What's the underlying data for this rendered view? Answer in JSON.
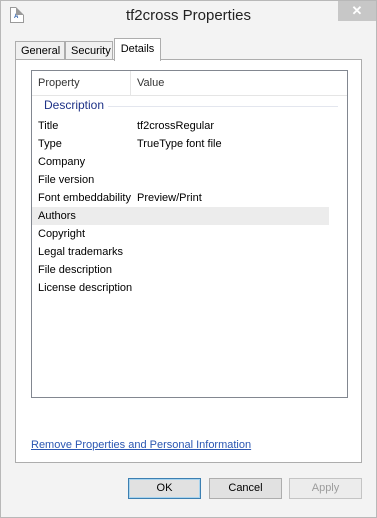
{
  "window": {
    "title": "tf2cross Properties",
    "close_glyph": "✕",
    "icon": "font-file-icon",
    "icon_glyph": "A"
  },
  "tabs": [
    {
      "label": "General",
      "selected": false
    },
    {
      "label": "Security",
      "selected": false
    },
    {
      "label": "Details",
      "selected": true
    }
  ],
  "details": {
    "columns": {
      "property": "Property",
      "value": "Value"
    },
    "group": "Description",
    "rows": [
      {
        "property": "Title",
        "value": "tf2crossRegular"
      },
      {
        "property": "Type",
        "value": "TrueType font file"
      },
      {
        "property": "Company",
        "value": ""
      },
      {
        "property": "File version",
        "value": ""
      },
      {
        "property": "Font embeddability",
        "value": "Preview/Print"
      },
      {
        "property": "Authors",
        "value": ""
      },
      {
        "property": "Copyright",
        "value": ""
      },
      {
        "property": "Legal trademarks",
        "value": ""
      },
      {
        "property": "File description",
        "value": ""
      },
      {
        "property": "License description",
        "value": ""
      }
    ],
    "highlighted_row": "Authors"
  },
  "link": {
    "label": "Remove Properties and Personal Information"
  },
  "buttons": {
    "ok": "OK",
    "cancel": "Cancel",
    "apply": "Apply",
    "apply_enabled": false
  },
  "colors": {
    "group_header": "#1e3287",
    "link": "#2a56b2",
    "close_button_bg": "#c7c7c7"
  }
}
